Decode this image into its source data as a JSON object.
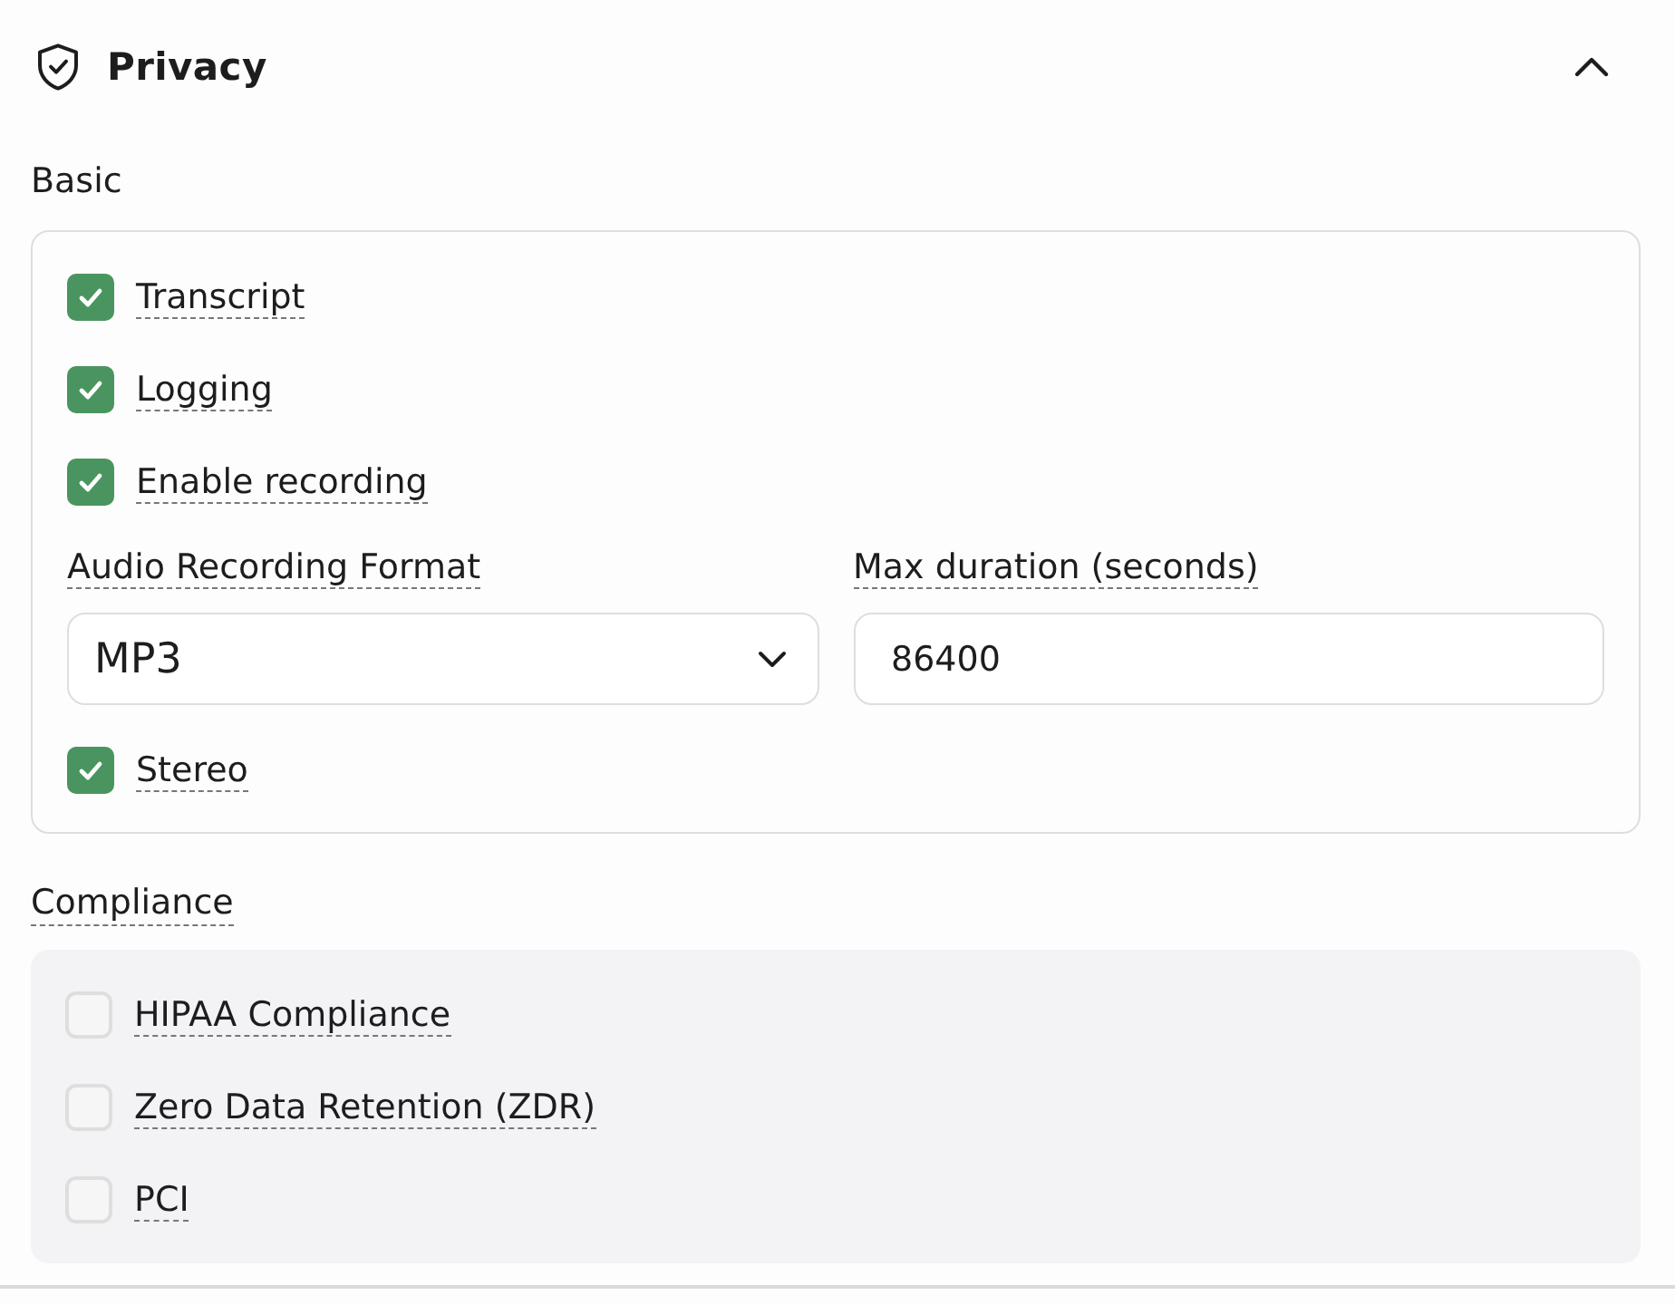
{
  "section": {
    "title": "Privacy",
    "expanded": true
  },
  "basic": {
    "heading": "Basic",
    "toggles": [
      {
        "label": "Transcript",
        "checked": true
      },
      {
        "label": "Logging",
        "checked": true
      },
      {
        "label": "Enable recording",
        "checked": true
      }
    ],
    "audio_format": {
      "label": "Audio Recording Format",
      "value": "MP3"
    },
    "max_duration": {
      "label": "Max duration (seconds)",
      "value": "86400"
    },
    "stereo": {
      "label": "Stereo",
      "checked": true
    }
  },
  "compliance": {
    "heading": "Compliance",
    "options": [
      {
        "label": "HIPAA Compliance",
        "checked": false
      },
      {
        "label": "Zero Data Retention (ZDR)",
        "checked": false
      },
      {
        "label": "PCI",
        "checked": false
      }
    ]
  }
}
